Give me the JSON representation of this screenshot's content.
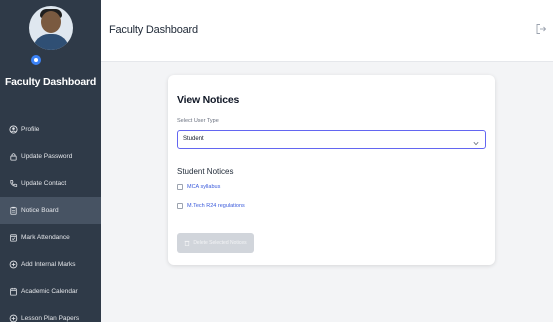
{
  "sidebar": {
    "brand": "Faculty Dashboard",
    "items": [
      {
        "label": "Profile",
        "icon": "user-circle-icon"
      },
      {
        "label": "Update Password",
        "icon": "lock-icon"
      },
      {
        "label": "Update Contact",
        "icon": "phone-icon"
      },
      {
        "label": "Notice Board",
        "icon": "clipboard-icon"
      },
      {
        "label": "Mark Attendance",
        "icon": "calendar-check-icon"
      },
      {
        "label": "Add Internal Marks",
        "icon": "plus-circle-icon"
      },
      {
        "label": "Academic Calendar",
        "icon": "calendar-icon"
      },
      {
        "label": "Lesson Plan Papers",
        "icon": "plus-circle-icon"
      }
    ]
  },
  "header": {
    "title": "Faculty Dashboard",
    "logout_icon": "logout-icon"
  },
  "card": {
    "title": "View Notices",
    "user_type_label": "Select User Type",
    "user_type_value": "Student",
    "section_title": "Student Notices",
    "notices": [
      {
        "label": "MCA syllabus"
      },
      {
        "label": "M.Tech R24 regulations"
      }
    ],
    "delete_label": "Delete Selected Notices"
  },
  "colors": {
    "sidebar_bg": "#2f3a48",
    "active_item_bg": "#475363",
    "accent": "#6366f1",
    "link": "#3b5bdb"
  }
}
